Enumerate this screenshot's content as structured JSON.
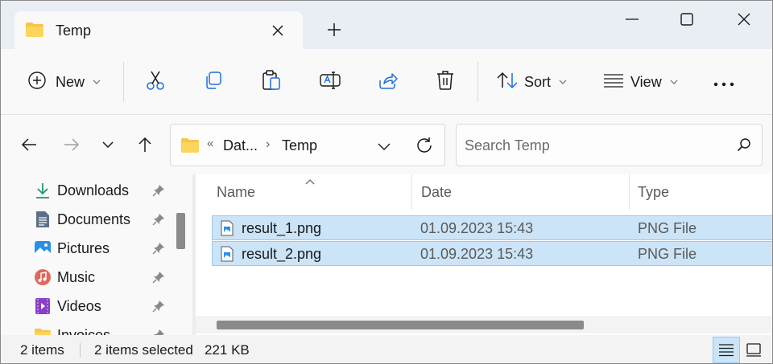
{
  "tab": {
    "title": "Temp"
  },
  "toolbar": {
    "new_label": "New",
    "sort_label": "Sort",
    "view_label": "View"
  },
  "address": {
    "overflow": "«",
    "crumbs": [
      "Dat...",
      "Temp"
    ],
    "separator": "›"
  },
  "search": {
    "placeholder": "Search Temp"
  },
  "sidebar": {
    "items": [
      {
        "label": "Downloads",
        "icon": "download-icon"
      },
      {
        "label": "Documents",
        "icon": "documents-icon"
      },
      {
        "label": "Pictures",
        "icon": "pictures-icon"
      },
      {
        "label": "Music",
        "icon": "music-icon"
      },
      {
        "label": "Videos",
        "icon": "videos-icon"
      },
      {
        "label": "Invoices",
        "icon": "folder-icon"
      }
    ]
  },
  "columns": {
    "name": "Name",
    "date": "Date",
    "type": "Type"
  },
  "files": [
    {
      "name": "result_1.png",
      "date": "01.09.2023 15:43",
      "type": "PNG File",
      "selected": true
    },
    {
      "name": "result_2.png",
      "date": "01.09.2023 15:43",
      "type": "PNG File",
      "selected": true
    }
  ],
  "status": {
    "count": "2 items",
    "selected": "2 items selected",
    "size": "221 KB"
  },
  "colors": {
    "selection_fill": "#cce4f7",
    "selection_border": "#99c9ef",
    "folder_yellow": "#f8c548",
    "accent_blue": "#1e6fd9"
  }
}
